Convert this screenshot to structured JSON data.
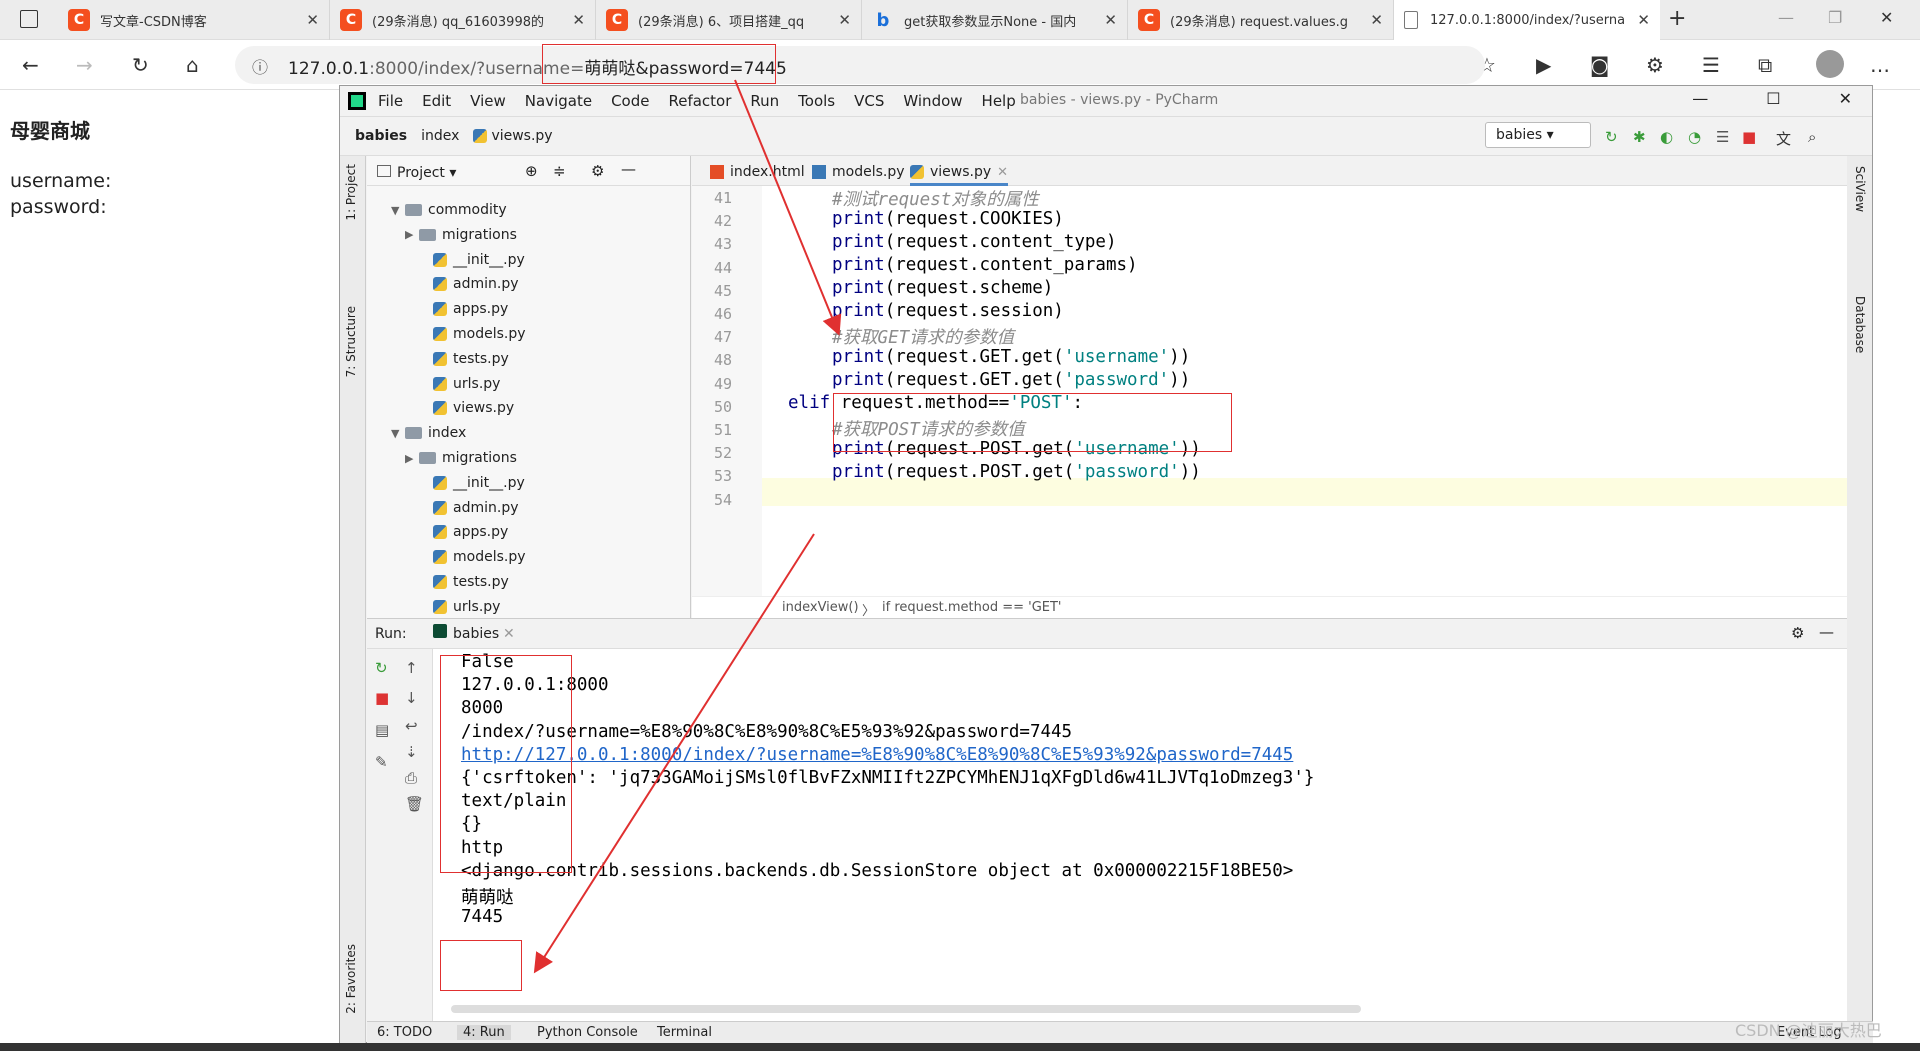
{
  "browser": {
    "tabs": [
      {
        "label": "写文章-CSDN博客",
        "icon": "csdn-icon"
      },
      {
        "label": "(29条消息) qq_61603998的",
        "icon": "csdn-icon"
      },
      {
        "label": "(29条消息) 6、项目搭建_qq",
        "icon": "csdn-icon"
      },
      {
        "label": "get获取参数显示None - 国内",
        "icon": "bing-icon"
      },
      {
        "label": "(29条消息) request.values.g",
        "icon": "csdn-icon"
      },
      {
        "label": "127.0.0.1:8000/index/?userna",
        "icon": "page-icon"
      }
    ],
    "url_host": "127.0.0.1",
    "url_rest": ":8000/index/?username=",
    "url_highlight": "萌萌哒&password=7445",
    "translate_label": "aあ"
  },
  "page": {
    "title": "母婴商城",
    "username_label": "username:",
    "password_label": "password:"
  },
  "pycharm": {
    "menu": [
      "File",
      "Edit",
      "View",
      "Navigate",
      "Code",
      "Refactor",
      "Run",
      "Tools",
      "VCS",
      "Window",
      "Help"
    ],
    "title": "babies - views.py - PyCharm",
    "nav": {
      "project": "babies",
      "folder": "index",
      "file": "views.py"
    },
    "run_config": "babies",
    "left_strip": {
      "project": "1: Project",
      "structure": "7: Structure",
      "favorites": "2: Favorites"
    },
    "right_strip": {
      "sciview": "SciView",
      "database": "Database"
    },
    "project_panel": {
      "header": "Project",
      "items": [
        {
          "label": "commodity",
          "kind": "folder",
          "open": true
        },
        {
          "label": "migrations",
          "kind": "folder",
          "open": false
        },
        {
          "label": "__init__.py",
          "kind": "py"
        },
        {
          "label": "admin.py",
          "kind": "py"
        },
        {
          "label": "apps.py",
          "kind": "py"
        },
        {
          "label": "models.py",
          "kind": "py"
        },
        {
          "label": "tests.py",
          "kind": "py"
        },
        {
          "label": "urls.py",
          "kind": "py"
        },
        {
          "label": "views.py",
          "kind": "py"
        },
        {
          "label": "index",
          "kind": "folder",
          "open": true
        },
        {
          "label": "migrations",
          "kind": "folder",
          "open": false
        },
        {
          "label": "__init__.py",
          "kind": "py"
        },
        {
          "label": "admin.py",
          "kind": "py"
        },
        {
          "label": "apps.py",
          "kind": "py"
        },
        {
          "label": "models.py",
          "kind": "py"
        },
        {
          "label": "tests.py",
          "kind": "py"
        },
        {
          "label": "urls.py",
          "kind": "py"
        }
      ]
    },
    "editor_tabs": [
      "index.html",
      "models.py",
      "views.py"
    ],
    "line_numbers": [
      "41",
      "42",
      "43",
      "44",
      "45",
      "46",
      "47",
      "48",
      "49",
      "50",
      "51",
      "52",
      "53",
      "54"
    ],
    "code": {
      "l41": "#测试request对象的属性",
      "l42a": "print",
      "l42b": "(request.COOKIES)",
      "l43a": "print",
      "l43b": "(request.content_type)",
      "l44a": "print",
      "l44b": "(request.content_params)",
      "l45a": "print",
      "l45b": "(request.scheme)",
      "l46a": "print",
      "l46b": "(request.session)",
      "l47": "#获取GET请求的参数值",
      "l48a": "print",
      "l48b": "(request.GET.get(",
      "l48c": "'username'",
      "l48d": "))",
      "l49a": "print",
      "l49b": "(request.GET.get(",
      "l49c": "'password'",
      "l49d": "))",
      "l50a": "elif",
      "l50b": " request.method==",
      "l50c": "'POST'",
      "l50d": ":",
      "l51": "#获取POST请求的参数值",
      "l52a": "print",
      "l52b": "(request.POST.get(",
      "l52c": "'username'",
      "l52d": "))",
      "l53a": "print",
      "l53b": "(request.POST.get(",
      "l53c": "'password'",
      "l53d": "))"
    },
    "breadcrumb": {
      "func": "indexView()",
      "cond": "if request.method == 'GET'"
    },
    "run": {
      "label": "Run:",
      "tab": "babies",
      "output": [
        "False",
        "127.0.0.1:8000",
        "8000",
        "/index/?username=%E8%90%8C%E8%90%8C%E5%93%92&password=7445",
        "http://127.0.0.1:8000/index/?username=%E8%90%8C%E8%90%8C%E5%93%92&password=7445",
        "{'csrftoken': 'jq733GAMoijSMsl0flBvFZxNMIIft2ZPCYMhENJ1qXFgDld6w41LJVTq1oDmzeg3'}",
        "text/plain",
        "{}",
        "http",
        "<django.contrib.sessions.backends.db.SessionStore object at 0x000002215F18BE50>",
        "萌萌哒",
        "7445"
      ]
    },
    "statusbar": {
      "todo": "6: TODO",
      "run": "4: Run",
      "console": "Python Console",
      "terminal": "Terminal",
      "event": "Event Log"
    }
  },
  "watermark": "CSDN @迪丽大热巴",
  "colors": {
    "annotation_red": "#e03030",
    "keyword": "#000080",
    "string": "#008080",
    "link": "#2066c9"
  }
}
